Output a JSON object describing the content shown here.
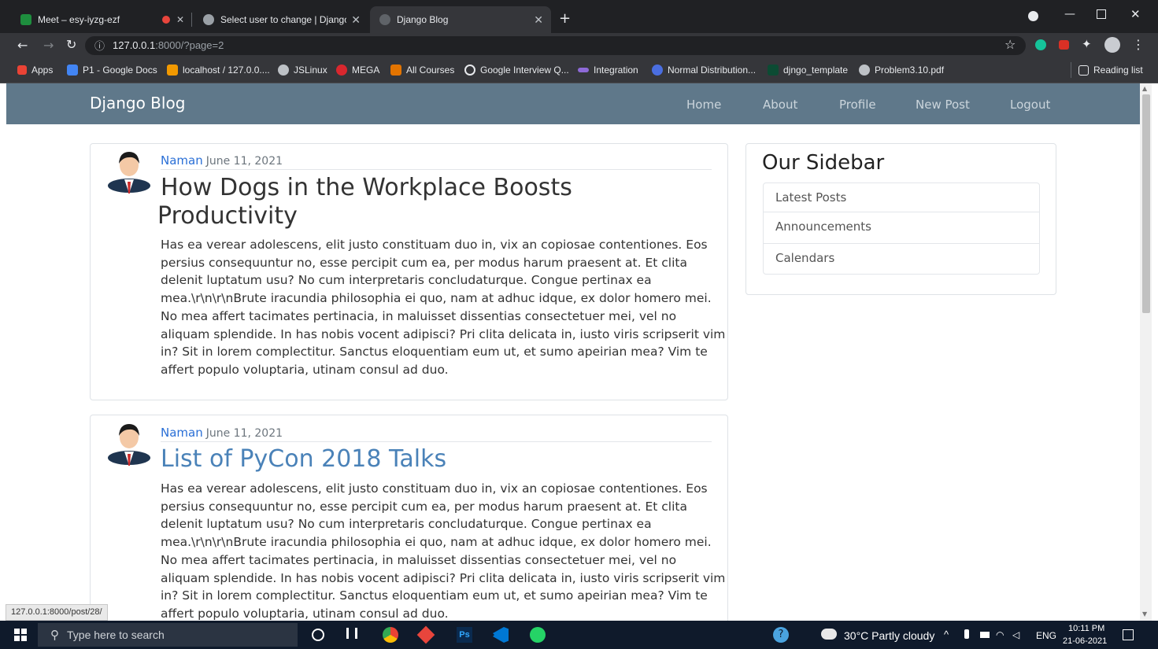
{
  "browser": {
    "tabs": [
      {
        "label": "Meet – esy-iyzg-ezf",
        "active": false
      },
      {
        "label": "Select user to change | Django si",
        "active": false
      },
      {
        "label": "Django Blog",
        "active": true
      }
    ],
    "new_tab": "+",
    "address": {
      "host": "127.0.0.1",
      "rest": ":8000/?page=2"
    },
    "bookmarks": [
      "Apps",
      "P1 - Google Docs",
      "localhost / 127.0.0....",
      "JSLinux",
      "MEGA",
      "All Courses",
      "Google Interview Q...",
      "Integration",
      "Normal Distribution...",
      "djngo_template",
      "Problem3.10.pdf"
    ],
    "reading_list": "Reading list",
    "status_url": "127.0.0.1:8000/post/28/"
  },
  "site": {
    "brand": "Django Blog",
    "nav": [
      "Home",
      "About",
      "Profile",
      "New Post",
      "Logout"
    ]
  },
  "posts": [
    {
      "author": "Naman",
      "date": "June 11, 2021",
      "title_line1": "How Dogs in the Workplace Boosts",
      "title_line2": "Productivity",
      "body": [
        "Has ea verear adolescens, elit justo constituam duo in, vix an copiosae contentiones. Eos",
        "persius consequuntur no, esse percipit cum ea, per modus harum praesent at. Et clita",
        "delenit luptatum usu? No cum interpretaris concludaturque. Congue pertinax ea",
        "mea.\\r\\n\\r\\nBrute iracundia philosophia ei quo, nam at adhuc idque, ex dolor homero mei.",
        "No mea affert tacimates pertinacia, in maluisset dissentias consectetuer mei, vel no",
        "aliquam splendide. In has nobis vocent adipisci? Pri clita delicata in, iusto viris scripserit vim",
        "in? Sit in lorem complectitur. Sanctus eloquentiam eum ut, et sumo apeirian mea? Vim te",
        "affert populo voluptaria, utinam consul ad duo."
      ]
    },
    {
      "author": "Naman",
      "date": "June 11, 2021",
      "title_line1": "List of PyCon 2018 Talks",
      "body": [
        "Has ea verear adolescens, elit justo constituam duo in, vix an copiosae contentiones. Eos",
        "persius consequuntur no, esse percipit cum ea, per modus harum praesent at. Et clita",
        "delenit luptatum usu? No cum interpretaris concludaturque. Congue pertinax ea",
        "mea.\\r\\n\\r\\nBrute iracundia philosophia ei quo, nam at adhuc idque, ex dolor homero mei.",
        "No mea affert tacimates pertinacia, in maluisset dissentias consectetuer mei, vel no",
        "aliquam splendide. In has nobis vocent adipisci? Pri clita delicata in, iusto viris scripserit vim",
        "in? Sit in lorem complectitur. Sanctus eloquentiam eum ut, et sumo apeirian mea? Vim te",
        "affert populo voluptaria, utinam consul ad duo."
      ]
    }
  ],
  "sidebar": {
    "title": "Our Sidebar",
    "items": [
      "Latest Posts",
      "Announcements",
      "Calendars"
    ]
  },
  "taskbar": {
    "search_placeholder": "Type here to search",
    "weather": "30°C  Partly cloudy",
    "lang": "ENG",
    "time": "10:11 PM",
    "date": "21-06-2021"
  },
  "colors": {
    "navbar": "#5f788a",
    "link": "#2a6fd6",
    "title2": "#4a82b8"
  }
}
